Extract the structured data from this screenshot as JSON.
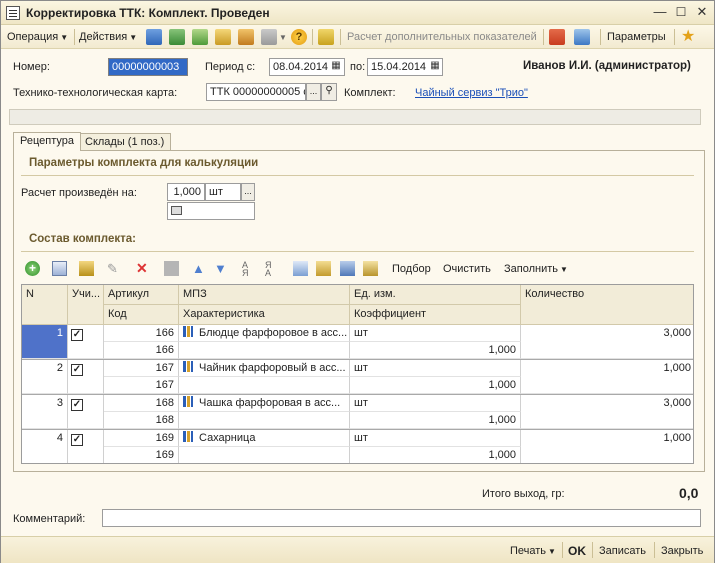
{
  "window": {
    "title": "Корректировка ТТК: Комплект. Проведен"
  },
  "toolbar": {
    "operation": "Операция",
    "actions": "Действия",
    "calc_additional": "Расчет дополнительных показателей",
    "parameters": "Параметры"
  },
  "form": {
    "number_label": "Номер:",
    "number_value": "00000000003",
    "period_from_label": "Период с:",
    "period_from_value": "08.04.2014",
    "period_to_label": "по:",
    "period_to_value": "15.04.2014",
    "user": "Иванов И.И. (администратор)",
    "ttk_label": "Технико-технологическая карта:",
    "ttk_value": "ТТК 00000000005 с",
    "ttk_choose": "...",
    "kit_label": "Комплект:",
    "kit_value": "Чайный сервиз \"Трио\""
  },
  "tabs": [
    {
      "label": "Рецептура"
    },
    {
      "label": "Склады (1 поз.)"
    }
  ],
  "params": {
    "section_title": "Параметры комплекта для калькуляции",
    "calc_label": "Расчет произведён на:",
    "calc_value": "1,000",
    "calc_unit": "шт",
    "unit_choose": "..."
  },
  "composition": {
    "section_title": "Состав комплекта:",
    "btn_select": "Подбор",
    "btn_clear": "Очистить",
    "btn_fill": "Заполнить"
  },
  "grid": {
    "headers": {
      "n": "N",
      "uch": "Учи...",
      "article": "Артикул",
      "code": "Код",
      "mpz": "МПЗ",
      "characteristic": "Характеристика",
      "unit": "Ед. изм.",
      "coefficient": "Коэффициент",
      "quantity": "Количество"
    },
    "rows": [
      {
        "n": "1",
        "article": "166",
        "code": "166",
        "mpz": "Блюдце фарфоровое в асс...",
        "unit": "шт",
        "coef": "1,000",
        "qty": "3,000"
      },
      {
        "n": "2",
        "article": "167",
        "code": "167",
        "mpz": "Чайник фарфоровый в асс...",
        "unit": "шт",
        "coef": "1,000",
        "qty": "1,000"
      },
      {
        "n": "3",
        "article": "168",
        "code": "168",
        "mpz": "Чашка фарфоровая в асс...",
        "unit": "шт",
        "coef": "1,000",
        "qty": "3,000"
      },
      {
        "n": "4",
        "article": "169",
        "code": "169",
        "mpz": "Сахарница",
        "unit": "шт",
        "coef": "1,000",
        "qty": "1,000"
      }
    ]
  },
  "totals": {
    "label": "Итого выход, гр:",
    "value": "0,0"
  },
  "comment": {
    "label": "Комментарий:",
    "value": ""
  },
  "footer": {
    "print": "Печать",
    "ok": "OK",
    "save": "Записать",
    "close": "Закрыть"
  }
}
